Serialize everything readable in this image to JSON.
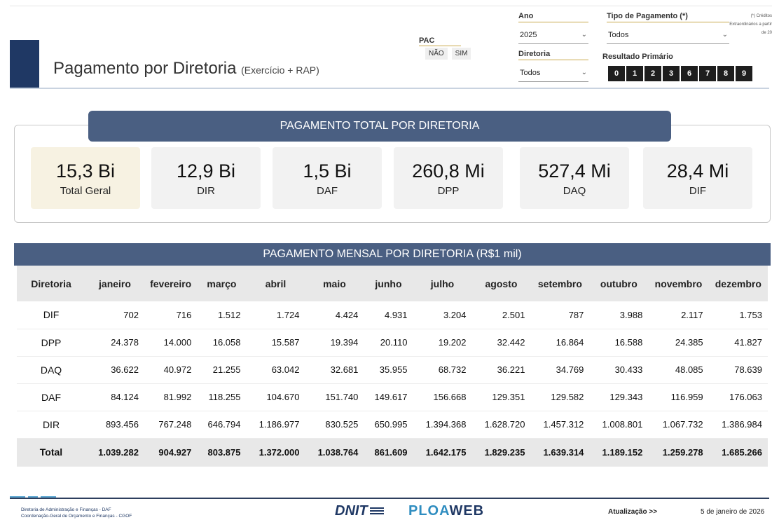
{
  "header": {
    "title": "Pagamento por Diretoria",
    "subtitle": "(Exercício + RAP)"
  },
  "filters": {
    "pac": {
      "label": "PAC",
      "options": [
        "NÃO",
        "SIM"
      ]
    },
    "ano": {
      "label": "Ano",
      "value": "2025"
    },
    "diretoria": {
      "label": "Diretoria",
      "value": "Todos"
    },
    "tipo_pagamento": {
      "label": "Tipo de Pagamento (*)",
      "value": "Todos"
    },
    "resultado_primario": {
      "label": "Resultado Primário",
      "options": [
        "0",
        "1",
        "2",
        "3",
        "6",
        "7",
        "8",
        "9"
      ]
    },
    "note": "(*) Créditos Extraordinários a partir de 20"
  },
  "total_section": {
    "title": "PAGAMENTO TOTAL POR DIRETORIA",
    "cards": [
      {
        "value": "15,3 Bi",
        "label": "Total Geral"
      },
      {
        "value": "12,9 Bi",
        "label": "DIR"
      },
      {
        "value": "1,5 Bi",
        "label": "DAF"
      },
      {
        "value": "260,8 Mi",
        "label": "DPP"
      },
      {
        "value": "527,4 Mi",
        "label": "DAQ"
      },
      {
        "value": "28,4 Mi",
        "label": "DIF"
      }
    ]
  },
  "monthly_section": {
    "title": "PAGAMENTO MENSAL POR DIRETORIA  (R$1 mil)",
    "columns": [
      "Diretoria",
      "janeiro",
      "fevereiro",
      "março",
      "abril",
      "maio",
      "junho",
      "julho",
      "agosto",
      "setembro",
      "outubro",
      "novembro",
      "dezembro"
    ],
    "rows": [
      [
        "DIF",
        "702",
        "716",
        "1.512",
        "1.724",
        "4.424",
        "4.931",
        "3.204",
        "2.501",
        "787",
        "3.988",
        "2.117",
        "1.753"
      ],
      [
        "DPP",
        "24.378",
        "14.000",
        "16.058",
        "15.587",
        "19.394",
        "20.110",
        "19.202",
        "32.442",
        "16.864",
        "16.588",
        "24.385",
        "41.827"
      ],
      [
        "DAQ",
        "36.622",
        "40.972",
        "21.255",
        "63.042",
        "32.681",
        "35.955",
        "68.732",
        "36.221",
        "34.769",
        "30.433",
        "48.085",
        "78.639"
      ],
      [
        "DAF",
        "84.124",
        "81.992",
        "118.255",
        "104.670",
        "151.740",
        "149.617",
        "156.668",
        "129.351",
        "129.582",
        "129.343",
        "116.959",
        "176.063"
      ],
      [
        "DIR",
        "893.456",
        "767.248",
        "646.794",
        "1.186.977",
        "830.525",
        "650.995",
        "1.394.368",
        "1.628.720",
        "1.457.312",
        "1.008.801",
        "1.067.732",
        "1.386.984"
      ]
    ],
    "total_row": [
      "Total",
      "1.039.282",
      "904.927",
      "803.875",
      "1.372.000",
      "1.038.764",
      "861.609",
      "1.642.175",
      "1.829.235",
      "1.639.314",
      "1.189.152",
      "1.259.278",
      "1.685.266"
    ]
  },
  "footer": {
    "org_line1": "Diretoria de Administração e Finanças - DAF",
    "org_line2": "Coordenação-Geral de Orçamento e Finanças - CGOF",
    "logo1": "DNIT",
    "logo2_a": "PLOA",
    "logo2_b": "WEB",
    "update_label": "Atualização >>",
    "update_date": "5 de janeiro de 2026"
  },
  "colors": {
    "banner": "#4a5f82",
    "brand": "#1f3864",
    "highlight_card": "#f7f2e2",
    "table_header": "#e8e8e8"
  }
}
